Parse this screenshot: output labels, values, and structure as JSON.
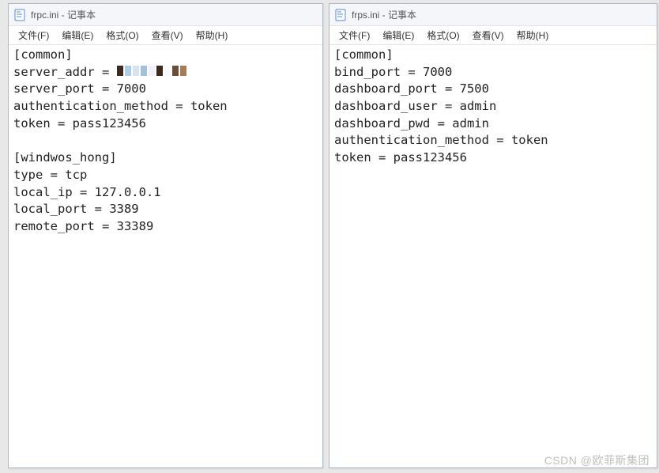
{
  "left": {
    "title": "frpc.ini - 记事本",
    "menu": [
      "文件(F)",
      "编辑(E)",
      "格式(O)",
      "查看(V)",
      "帮助(H)"
    ],
    "content": {
      "common_header": "[common]",
      "server_addr_key": "server_addr = ",
      "server_port": "server_port = 7000",
      "auth_method": "authentication_method = token",
      "token": "token = pass123456",
      "blank": "",
      "section2": "[windwos_hong]",
      "type": "type = tcp",
      "local_ip": "local_ip = 127.0.0.1",
      "local_port": "local_port = 3389",
      "remote_port": "remote_port = 33389"
    }
  },
  "right": {
    "title": "frps.ini - 记事本",
    "menu": [
      "文件(F)",
      "编辑(E)",
      "格式(O)",
      "查看(V)",
      "帮助(H)"
    ],
    "content_lines": [
      "[common]",
      "bind_port = 7000",
      "dashboard_port = 7500",
      "dashboard_user = admin",
      "dashboard_pwd = admin",
      "authentication_method = token",
      "token = pass123456"
    ]
  },
  "watermark": "CSDN @欧菲斯集团"
}
